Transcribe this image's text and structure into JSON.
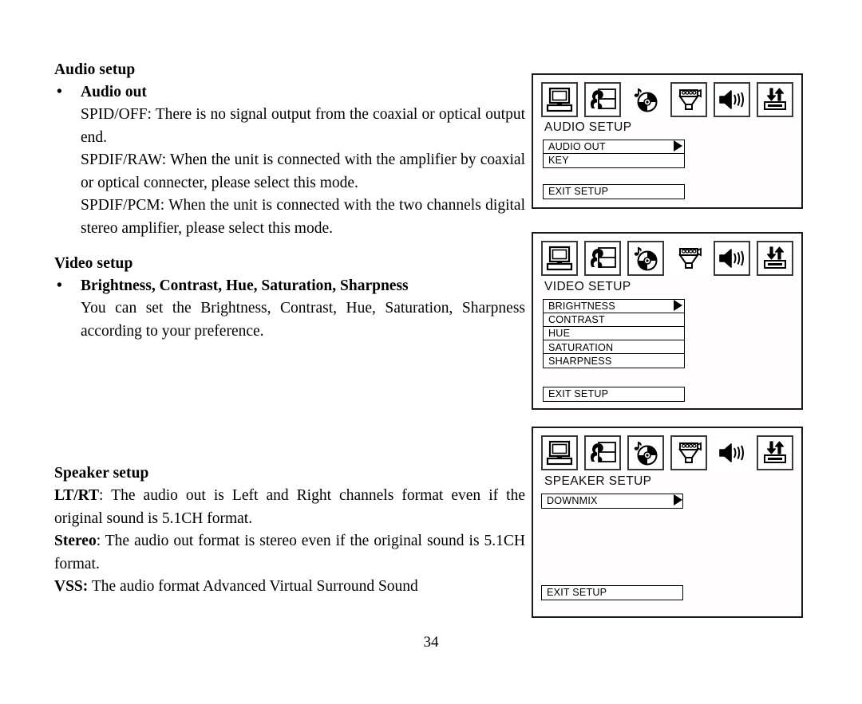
{
  "document": {
    "page_number": "34"
  },
  "sections": [
    {
      "id": "audio",
      "title": "Audio setup",
      "bullet": "Audio out",
      "bullet_glyph": "•",
      "paragraphs": [
        "SPID/OFF: There is no signal output from the coaxial or optical output end.",
        "SPDIF/RAW: When the unit is connected with the amplifier by coaxial or optical connecter, please select this mode.",
        "SPDIF/PCM: When the unit is connected with the two channels digital stereo amplifier, please select this mode."
      ]
    },
    {
      "id": "video",
      "title": "Video setup",
      "bullet": "Brightness, Contrast, Hue, Saturation, Sharpness",
      "bullet_glyph": "•",
      "paragraphs": [
        "You can set the Brightness, Contrast, Hue, Saturation, Sharpness according to your preference."
      ]
    },
    {
      "id": "speaker",
      "title": "Speaker setup",
      "lines": [
        {
          "lead": "LT/RT",
          "sep": ": ",
          "rest": "The audio out is Left and Right channels format even if the original sound is 5.1CH format."
        },
        {
          "lead": "Stereo",
          "sep": ": ",
          "rest": "The audio out format is stereo even if the original sound is 5.1CH format."
        },
        {
          "lead": "VSS:",
          "sep": " ",
          "rest": "The audio format Advanced Virtual Surround Sound"
        }
      ]
    }
  ],
  "osd_panels": [
    {
      "id": "audio-setup",
      "heading": "AUDIO SETUP",
      "icons": [
        {
          "name": "tv-monitor-icon",
          "label": "General Setup",
          "boxed": true
        },
        {
          "name": "person-screen-preferences-icon",
          "label": "Preferences",
          "boxed": true
        },
        {
          "name": "disc-music-note-icon",
          "label": "Audio Setup",
          "boxed": false
        },
        {
          "name": "speaker-cabinet-icon",
          "label": "Speaker Setup",
          "boxed": true
        },
        {
          "name": "speaker-waves-icon",
          "label": "Audio",
          "boxed": true
        },
        {
          "name": "tray-up-down-arrows-icon",
          "label": "Exit Setup",
          "boxed": true
        }
      ],
      "items": [
        "AUDIO OUT",
        "KEY"
      ],
      "exit_label": "EXIT SETUP",
      "pointer_index": 0
    },
    {
      "id": "video-setup",
      "heading": "VIDEO SETUP",
      "icons": [
        {
          "name": "tv-monitor-icon",
          "label": "General Setup",
          "boxed": true
        },
        {
          "name": "person-screen-preferences-icon",
          "label": "Preferences",
          "boxed": true
        },
        {
          "name": "disc-music-note-icon",
          "label": "Audio Setup",
          "boxed": true
        },
        {
          "name": "speaker-cabinet-icon",
          "label": "Speaker Setup",
          "boxed": false
        },
        {
          "name": "speaker-waves-icon",
          "label": "Audio",
          "boxed": true
        },
        {
          "name": "tray-up-down-arrows-icon",
          "label": "Exit Setup",
          "boxed": true
        }
      ],
      "items": [
        "BRIGHTNESS",
        "CONTRAST",
        "HUE",
        "SATURATION",
        "SHARPNESS"
      ],
      "exit_label": "EXIT SETUP",
      "pointer_index": 0
    },
    {
      "id": "speaker-setup",
      "heading": "SPEAKER SETUP",
      "icons": [
        {
          "name": "tv-monitor-icon",
          "label": "General Setup",
          "boxed": true
        },
        {
          "name": "person-screen-preferences-icon",
          "label": "Preferences",
          "boxed": true
        },
        {
          "name": "disc-music-note-icon",
          "label": "Audio Setup",
          "boxed": true
        },
        {
          "name": "speaker-cabinet-icon",
          "label": "Speaker Setup",
          "boxed": true
        },
        {
          "name": "speaker-waves-icon",
          "label": "Audio",
          "boxed": false
        },
        {
          "name": "tray-up-down-arrows-icon",
          "label": "Exit Setup",
          "boxed": true
        }
      ],
      "items": [
        "DOWNMIX"
      ],
      "exit_label": "EXIT SETUP",
      "pointer_index": 0
    }
  ],
  "colors": {
    "ink": "#000000",
    "panel_border": "#1a1a1a",
    "panel_bg": "#fffdfe",
    "icon_box_border": "#3a3a3a"
  }
}
